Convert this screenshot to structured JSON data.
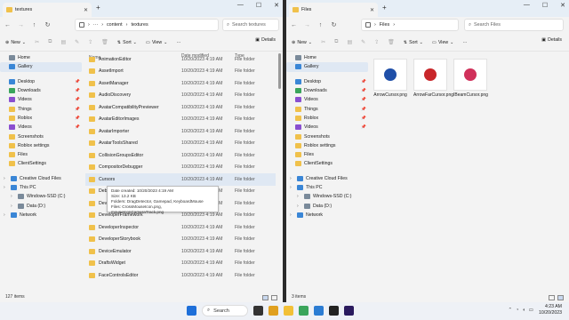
{
  "left": {
    "tab_title": "textures",
    "address": {
      "sep": "›",
      "more": "···",
      "crumbs": [
        "content",
        "textures"
      ]
    },
    "search_placeholder": "Search textures",
    "cmd": {
      "new": "New",
      "sort": "Sort",
      "view": "View",
      "more": "···",
      "details": "Details"
    },
    "sidebar": [
      {
        "label": "Home",
        "icon": "home-icon",
        "pin": false
      },
      {
        "label": "Gallery",
        "icon": "gallery-icon",
        "pin": false,
        "sel": true
      },
      {
        "label": "Desktop",
        "icon": "desktop-icon",
        "pin": true,
        "gap": true
      },
      {
        "label": "Downloads",
        "icon": "download-icon",
        "pin": true
      },
      {
        "label": "Videos",
        "icon": "video-icon",
        "pin": true
      },
      {
        "label": "Things",
        "icon": "folder-icon",
        "pin": true
      },
      {
        "label": "Roblox",
        "icon": "folder-icon",
        "pin": true
      },
      {
        "label": "Videos",
        "icon": "video-icon",
        "pin": true
      },
      {
        "label": "Screenshots",
        "icon": "folder-icon",
        "pin": false
      },
      {
        "label": "Roblox settings",
        "icon": "folder-icon",
        "pin": false
      },
      {
        "label": "Files",
        "icon": "folder-icon",
        "pin": false
      },
      {
        "label": "ClientSettings",
        "icon": "folder-icon",
        "pin": false
      },
      {
        "label": "Creative Cloud Files",
        "icon": "cloud-icon",
        "pin": false,
        "gap": true,
        "chev": true
      },
      {
        "label": "This PC",
        "icon": "pc-icon",
        "pin": false,
        "chev": true
      },
      {
        "label": "Windows-SSD (C:)",
        "icon": "drive-icon",
        "pin": false,
        "chev": true,
        "indent": true
      },
      {
        "label": "Data (D:)",
        "icon": "drive-icon",
        "pin": false,
        "chev": true,
        "indent": true
      },
      {
        "label": "Network",
        "icon": "network-icon",
        "pin": false,
        "chev": true
      }
    ],
    "columns": {
      "name": "Name",
      "date": "Date modified",
      "type": "Type"
    },
    "rows": [
      {
        "name": "AnimationEditor",
        "date": "10/20/2023 4:19 AM",
        "type": "File folder"
      },
      {
        "name": "AssetImport",
        "date": "10/20/2023 4:19 AM",
        "type": "File folder"
      },
      {
        "name": "AssetManager",
        "date": "10/20/2023 4:19 AM",
        "type": "File folder"
      },
      {
        "name": "AudioDiscovery",
        "date": "10/20/2023 4:19 AM",
        "type": "File folder"
      },
      {
        "name": "AvatarCompatibilityPreviewer",
        "date": "10/20/2023 4:19 AM",
        "type": "File folder"
      },
      {
        "name": "AvatarEditorImages",
        "date": "10/20/2023 4:19 AM",
        "type": "File folder"
      },
      {
        "name": "AvatarImporter",
        "date": "10/20/2023 4:19 AM",
        "type": "File folder"
      },
      {
        "name": "AvatarToolsShared",
        "date": "10/20/2023 4:19 AM",
        "type": "File folder"
      },
      {
        "name": "CollisionGroupsEditor",
        "date": "10/20/2023 4:19 AM",
        "type": "File folder"
      },
      {
        "name": "CompositorDebugger",
        "date": "10/20/2023 4:19 AM",
        "type": "File folder"
      },
      {
        "name": "Cursors",
        "date": "10/20/2023 4:19 AM",
        "type": "File folder",
        "hl": true
      },
      {
        "name": "Debug",
        "date": "10/20/2023 4:19 AM",
        "type": "File folder"
      },
      {
        "name": "DevCo",
        "date": "10/20/2023 4:19 AM",
        "type": "File folder"
      },
      {
        "name": "DeveloperFramework",
        "date": "10/20/2023 4:19 AM",
        "type": "File folder"
      },
      {
        "name": "DeveloperInspector",
        "date": "10/20/2023 4:19 AM",
        "type": "File folder"
      },
      {
        "name": "DeveloperStorybook",
        "date": "10/20/2023 4:19 AM",
        "type": "File folder"
      },
      {
        "name": "DeviceEmulator",
        "date": "10/20/2023 4:19 AM",
        "type": "File folder"
      },
      {
        "name": "DraftsWidget",
        "date": "10/20/2023 4:19 AM",
        "type": "File folder"
      },
      {
        "name": "FaceControlsEditor",
        "date": "10/20/2023 4:19 AM",
        "type": "File folder"
      }
    ],
    "tooltip": {
      "line1": "Date created: 10/20/2023 4:19 AM",
      "line2": "Size: 13.2 KB",
      "line3": "Folders: DragDetector, Gamepad, KeyboardMouse",
      "line4": "Files: CrossMouseIcon.png, mouseIconCameraTrack.png"
    },
    "status": "127 items"
  },
  "right": {
    "tab_title": "Files",
    "address": {
      "sep": "›",
      "crumbs": [
        "Files"
      ]
    },
    "search_placeholder": "Search Files",
    "cmd": {
      "new": "New",
      "sort": "Sort",
      "view": "View",
      "more": "···",
      "details": "Details"
    },
    "sidebar": [
      {
        "label": "Home",
        "icon": "home-icon",
        "pin": false
      },
      {
        "label": "Gallery",
        "icon": "gallery-icon",
        "pin": false,
        "sel": true
      },
      {
        "label": "Desktop",
        "icon": "desktop-icon",
        "pin": true,
        "gap": true
      },
      {
        "label": "Downloads",
        "icon": "download-icon",
        "pin": true
      },
      {
        "label": "Videos",
        "icon": "video-icon",
        "pin": true
      },
      {
        "label": "Things",
        "icon": "folder-icon",
        "pin": true
      },
      {
        "label": "Roblox",
        "icon": "folder-icon",
        "pin": true
      },
      {
        "label": "Videos",
        "icon": "video-icon",
        "pin": true
      },
      {
        "label": "Screenshots",
        "icon": "folder-icon",
        "pin": false
      },
      {
        "label": "Roblox settings",
        "icon": "folder-icon",
        "pin": false
      },
      {
        "label": "Files",
        "icon": "folder-icon",
        "pin": false
      },
      {
        "label": "ClientSettings",
        "icon": "folder-icon",
        "pin": false
      },
      {
        "label": "Creative Cloud Files",
        "icon": "cloud-icon",
        "pin": false,
        "gap": true,
        "chev": true
      },
      {
        "label": "This PC",
        "icon": "pc-icon",
        "pin": false,
        "chev": true
      },
      {
        "label": "Windows-SSD (C:)",
        "icon": "drive-icon",
        "pin": false,
        "chev": true,
        "indent": true
      },
      {
        "label": "Data (D:)",
        "icon": "drive-icon",
        "pin": false,
        "chev": true,
        "indent": true
      },
      {
        "label": "Network",
        "icon": "network-icon",
        "pin": false,
        "chev": true
      }
    ],
    "files": [
      {
        "name": "ArrowCursor.png",
        "color": "#1f4fa8"
      },
      {
        "name": "ArrowFarCursor.png",
        "color": "#c8262a"
      },
      {
        "name": "IBeamCursor.png",
        "color": "#d0305a"
      }
    ],
    "status": "3 items"
  },
  "taskbar": {
    "search": "Search",
    "time": "4:23 AM",
    "date": "10/20/2023",
    "apps": [
      {
        "name": "start-icon",
        "color": "#1e6fd9"
      },
      {
        "name": "taskview-icon",
        "color": "#333333"
      },
      {
        "name": "widgets-icon",
        "color": "#e0a020"
      },
      {
        "name": "explorer-icon",
        "color": "#f2c038"
      },
      {
        "name": "chrome-icon",
        "color": "#3aa55c"
      },
      {
        "name": "edge-icon",
        "color": "#2b7cd3"
      },
      {
        "name": "roblox-icon",
        "color": "#222222"
      },
      {
        "name": "premiere-icon",
        "color": "#2a1a5e"
      }
    ]
  }
}
